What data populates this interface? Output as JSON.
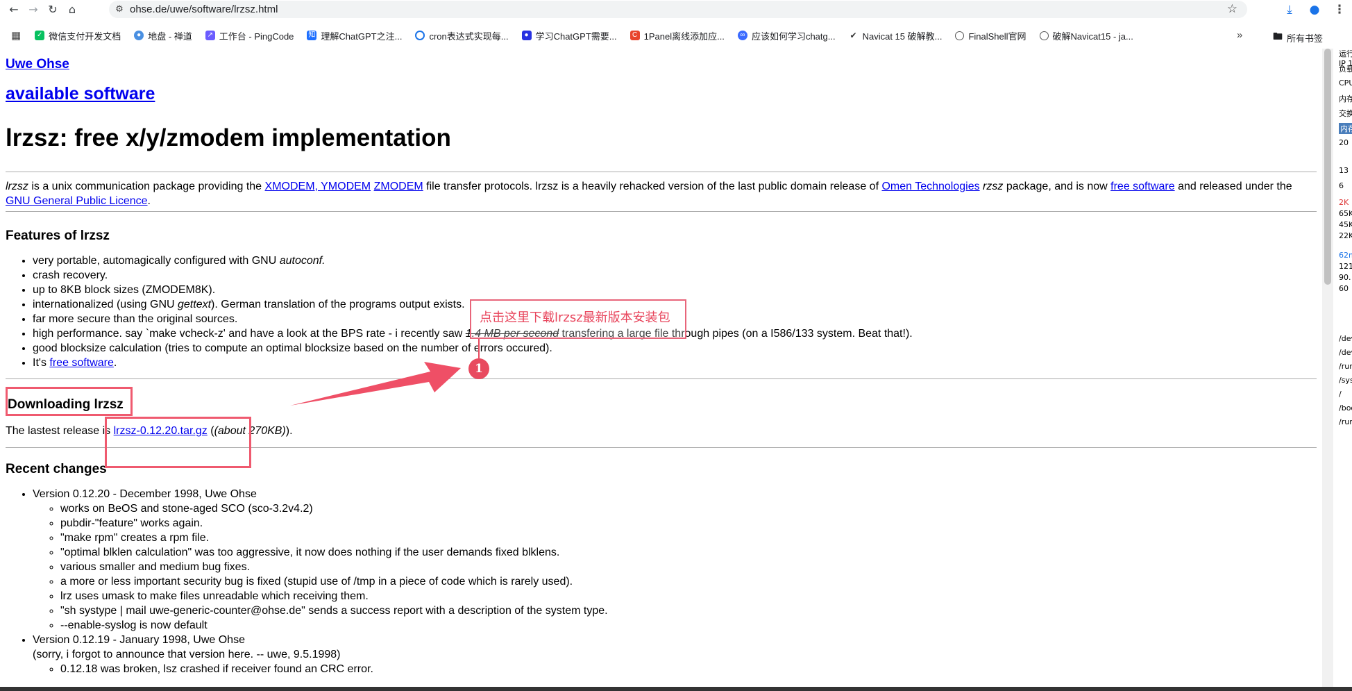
{
  "browser": {
    "url": "ohse.de/uwe/software/lrzsz.html"
  },
  "bookmarks": [
    {
      "label": "微信支付开发文档",
      "color": "#07c160"
    },
    {
      "label": "地盘 - 禅道",
      "color": "#4a90e2"
    },
    {
      "label": "工作台 - PingCode",
      "color": "#6b5cff"
    },
    {
      "label": "理解ChatGPT之注...",
      "color": "#1e6fff"
    },
    {
      "label": "cron表达式实现每...",
      "color": "#1a73e8"
    },
    {
      "label": "学习ChatGPT需要...",
      "color": "#2932e1"
    },
    {
      "label": "1Panel离线添加应...",
      "color": "#e8452c"
    },
    {
      "label": "应该如何学习chatg...",
      "color": "#3b6bff"
    },
    {
      "label": "Navicat 15 破解教...",
      "color": "#555555"
    },
    {
      "label": "FinalShell官网",
      "color": "#555555"
    },
    {
      "label": "破解Navicat15 - ja...",
      "color": "#555555"
    }
  ],
  "bookmarks_folder": "所有书签",
  "page": {
    "author_link": "Uwe Ohse",
    "software_link": "available software",
    "title": "lrzsz: free x/y/zmodem implementation",
    "intro": {
      "part1": "lrzsz",
      "part2": " is a unix communication package providing the ",
      "link_xy": "XMODEM, YMODEM",
      "space": " ",
      "link_z": "ZMODEM",
      "part3": " file transfer protocols. lrzsz is a heavily rehacked version of the last public domain release of ",
      "link_omen": "Omen Technologies",
      "part4": " ",
      "rzsz": "rzsz",
      "part5": " package, and is now ",
      "link_free": "free software",
      "part6": " and released under the ",
      "link_gpl": "GNU General Public Licence",
      "part7": "."
    },
    "features_title": "Features of lrzsz",
    "features": {
      "f1a": "very portable, automagically configured with GNU ",
      "f1b": "autoconf.",
      "f2": "crash recovery.",
      "f3": "up to 8KB block sizes (ZMODEM8K).",
      "f4a": "internationalized (using GNU ",
      "f4b": "gettext",
      "f4c": "). German translation of the programs output exists.",
      "f5": "far more secure than the original sources.",
      "f6a": "high performance. say `make vcheck-z' and have a look at the BPS rate - i recently saw ",
      "f6b": "1.4 MB per second",
      "f6c": " transfering a large file through pipes (on a I586/133 system. Beat that!).",
      "f7": "good blocksize calculation (tries to compute an optimal blocksize based on the number of errors occured).",
      "f8a": "It's ",
      "f8b": "free software",
      "f8c": "."
    },
    "downloading_title": "Downloading lrzsz",
    "release": {
      "pre": "The lastest release is ",
      "link": "lrzsz-0.12.20.tar.gz",
      "mid": " (",
      "size": "(about 270KB)",
      "post": ")."
    },
    "changes_title": "Recent changes",
    "v1": "Version 0.12.20 - December 1998, Uwe Ohse",
    "v1_items": [
      "works on BeOS and stone-aged SCO (sco-3.2v4.2)",
      "pubdir-\"feature\" works again.",
      "\"make rpm\" creates a rpm file.",
      "\"optimal blklen calculation\" was too aggressive, it now does nothing if the user demands fixed blklens.",
      "various smaller and medium bug fixes.",
      "a more or less important security bug is fixed (stupid use of /tmp in a piece of code which is rarely used).",
      "lrz uses umask to make files unreadable which receiving them.",
      "\"sh systype | mail uwe-generic-counter@ohse.de\" sends a success report with a description of the system type.",
      "--enable-syslog is now default"
    ],
    "v2": "Version 0.12.19 - January 1998, Uwe Ohse",
    "v2_note": "(sorry, i forgot to announce that version here. -- uwe, 9.5.1998)",
    "v2_items": [
      "0.12.18 was broken, lsz crashed if receiver found an CRC error."
    ]
  },
  "annotation": {
    "callout_text": "点击这里下载lrzsz最新版本安装包",
    "badge": "1"
  },
  "sidepanel": [
    "运行",
    "IP 1",
    "负载",
    "CPU",
    "内存",
    "交换",
    "内存",
    "20",
    "13",
    "6",
    "2K",
    "65K",
    "45K",
    "22K",
    "62m",
    "121",
    "90.",
    "60",
    "/dev",
    "/dev",
    "/run",
    "/sys",
    "/",
    "/boo",
    "/run"
  ]
}
